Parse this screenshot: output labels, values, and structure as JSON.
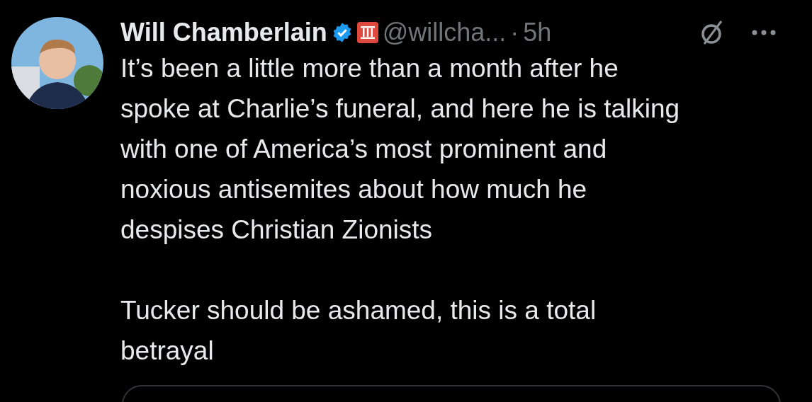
{
  "tweet": {
    "author": "Will Chamberlain",
    "verified": true,
    "handle": "@willcha...",
    "separator": "·",
    "time": "5h",
    "paragraphs": [
      [
        "It’s been a little more than a month after he",
        "spoke at Charlie’s funeral, and here he is talking",
        "with one of America’s most prominent and",
        "noxious antisemites about how much he",
        "despises Christian Zionists"
      ],
      [
        "Tucker should be ashamed, this is a total",
        "betrayal"
      ]
    ]
  }
}
